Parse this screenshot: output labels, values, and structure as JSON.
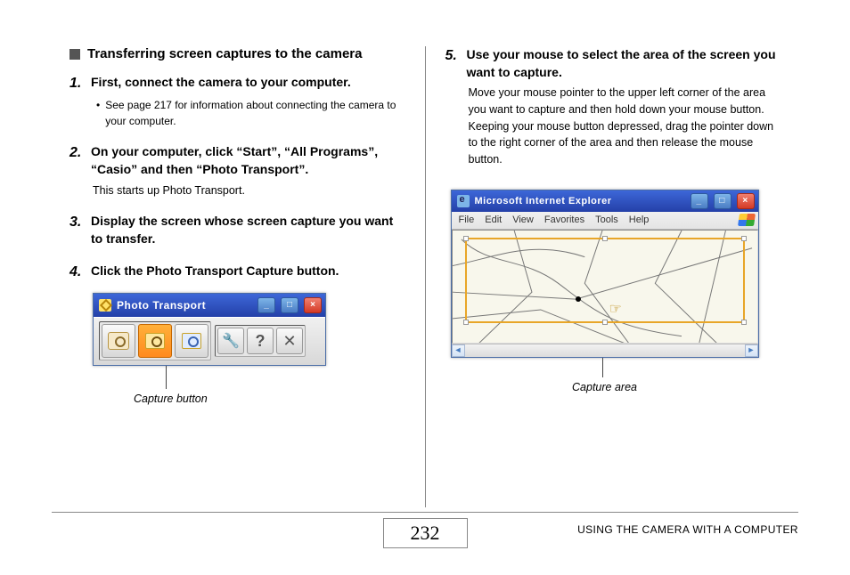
{
  "left": {
    "section_title": "Transferring screen captures to the camera",
    "step1": {
      "num": "1.",
      "title": "First, connect the camera to your computer.",
      "bullet": "See page 217 for information about connecting the camera to your computer."
    },
    "step2": {
      "num": "2.",
      "title": "On your computer, click “Start”, “All Programs”, “Casio” and then “Photo Transport”.",
      "body": "This starts up Photo Transport."
    },
    "step3": {
      "num": "3.",
      "title": "Display the screen whose screen capture you want to transfer."
    },
    "step4": {
      "num": "4.",
      "title": "Click the Photo Transport Capture button."
    },
    "pt_window": {
      "title": "Photo Transport",
      "min": "_",
      "max": "□",
      "close": "×",
      "btn_tool": "🔧",
      "btn_help": "?",
      "btn_x": "✕"
    },
    "caption": "Capture button"
  },
  "right": {
    "step5": {
      "num": "5.",
      "title": "Use your mouse to select the area of the screen you want to capture.",
      "body": "Move your mouse pointer to the upper left corner of the area you want to capture and then hold down your mouse button. Keeping your mouse button depressed, drag the pointer down to the right corner of the area and then release the mouse button."
    },
    "ie_window": {
      "title": "Microsoft Internet Explorer",
      "min": "_",
      "max": "□",
      "close": "×",
      "menu": [
        "File",
        "Edit",
        "View",
        "Favorites",
        "Tools",
        "Help"
      ],
      "scroll_left": "◄",
      "scroll_right": "►"
    },
    "caption": "Capture area"
  },
  "footer": {
    "page": "232",
    "label": "USING THE CAMERA WITH A COMPUTER"
  }
}
